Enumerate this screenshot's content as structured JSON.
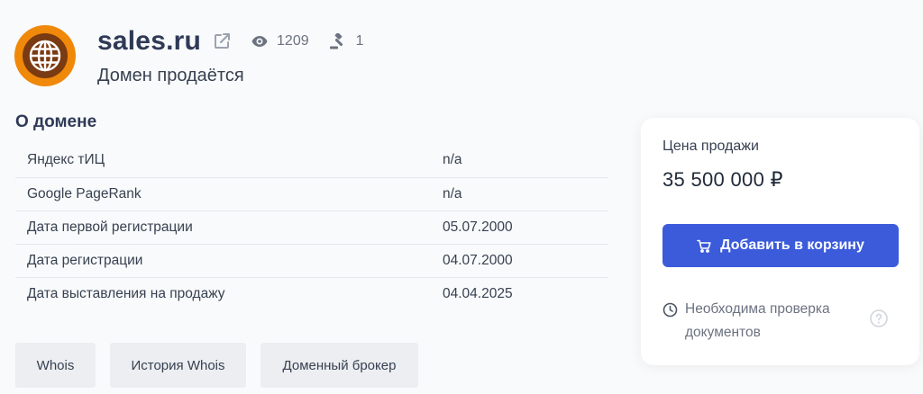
{
  "header": {
    "domain": "sales.ru",
    "views": "1209",
    "bids": "1",
    "status": "Домен продаётся"
  },
  "about": {
    "title": "О домене",
    "rows": [
      {
        "label": "Яндекс тИЦ",
        "value": "n/a"
      },
      {
        "label": "Google PageRank",
        "value": "n/a"
      },
      {
        "label": "Дата первой регистрации",
        "value": "05.07.2000"
      },
      {
        "label": "Дата регистрации",
        "value": "04.07.2000"
      },
      {
        "label": "Дата выставления на продажу",
        "value": "04.04.2025"
      }
    ]
  },
  "actions": {
    "whois": "Whois",
    "whois_history": "История Whois",
    "broker": "Доменный брокер"
  },
  "price_card": {
    "label": "Цена продажи",
    "price": "35 500 000 ₽",
    "cart_button": "Добавить в корзину",
    "notice": "Необходима проверка документов"
  },
  "icons": {
    "logo": "globe-icon",
    "external": "external-link-icon",
    "views": "eye-icon",
    "bids": "gavel-icon",
    "cart": "cart-icon",
    "clock": "clock-icon",
    "help": "help-icon"
  },
  "colors": {
    "accent": "#3b5bdb",
    "logo_outer": "#f0880a",
    "logo_inner": "#7a3a12",
    "title": "#2f3a57"
  }
}
